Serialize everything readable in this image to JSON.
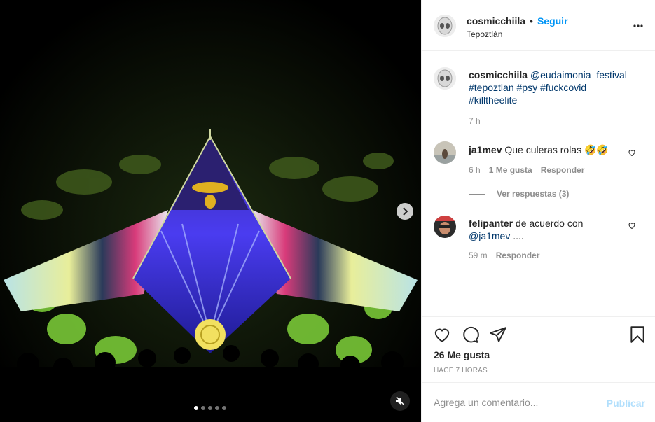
{
  "post": {
    "author": "cosmicchiila",
    "follow_separator": "•",
    "follow_label": "Seguir",
    "location": "Tepoztlán",
    "more_label": "Más opciones",
    "caption": {
      "mention": "@eudaimonia_festival",
      "hashtags": [
        "#tepoztlan",
        "#psy",
        "#fuckcovid",
        "#killtheelite"
      ],
      "time": "7 h"
    },
    "media": {
      "slide_count": 5,
      "active_slide": 1
    }
  },
  "comments": [
    {
      "username": "ja1mev",
      "text": "Que culeras rolas 🤣🤣",
      "time": "6 h",
      "likes": "1 Me gusta",
      "reply_label": "Responder",
      "view_replies": "Ver respuestas (3)"
    },
    {
      "username": "felipanter",
      "text": "de acuerdo con",
      "mention": "@ja1mev",
      "tail": "....",
      "time": "59 m",
      "reply_label": "Responder"
    }
  ],
  "actions": {
    "likes": "26 Me gusta",
    "time_ago": "HACE 7 HORAS"
  },
  "composer": {
    "placeholder": "Agrega un comentario...",
    "publish_label": "Publicar"
  },
  "icons": {
    "next": "chevron-right-icon",
    "mute": "speaker-muted-icon",
    "like": "heart-icon",
    "comment": "speech-bubble-icon",
    "share": "paper-plane-icon",
    "save": "bookmark-icon"
  },
  "colors": {
    "link": "#00376b",
    "accent": "#0095f6",
    "publish_disabled": "#b2dffc"
  }
}
